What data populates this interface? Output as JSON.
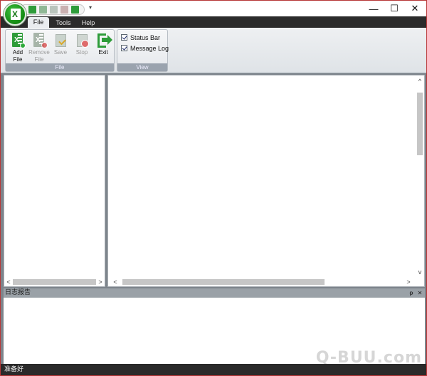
{
  "qat": {
    "icons": [
      "excel-add-icon",
      "excel-remove-icon",
      "save-icon",
      "stop-icon",
      "exit-icon"
    ],
    "dropdown_glyph": "▾"
  },
  "window_controls": {
    "minimize": "—",
    "maximize": "☐",
    "close": "✕"
  },
  "tabs": [
    {
      "label": "File",
      "active": true
    },
    {
      "label": "Tools",
      "active": false
    },
    {
      "label": "Help",
      "active": false
    }
  ],
  "ribbon": {
    "file_group": {
      "label": "File",
      "buttons": [
        {
          "line1": "Add",
          "line2": "File",
          "enabled": true
        },
        {
          "line1": "Remove",
          "line2": "File",
          "enabled": false
        },
        {
          "line1": "Save",
          "line2": "",
          "enabled": false
        },
        {
          "line1": "Stop",
          "line2": "",
          "enabled": false
        },
        {
          "line1": "Exit",
          "line2": "",
          "enabled": true
        }
      ]
    },
    "view_group": {
      "label": "View",
      "status_bar": {
        "label": "Status Bar",
        "checked": true
      },
      "message_log": {
        "label": "Message Log",
        "checked": true
      }
    }
  },
  "scroll": {
    "left": "<",
    "right": ">",
    "up": "^",
    "down": "v"
  },
  "log_panel": {
    "title": "日志报告",
    "pin": "ᵽ",
    "close": "✕"
  },
  "statusbar": {
    "text": "准备好"
  },
  "watermark": {
    "text": "Q-BUU.com"
  },
  "colors": {
    "accent_green": "#2e9c3a",
    "tab_bar": "#2b2b2b",
    "status_bar": "#2a2a2a",
    "window_border": "#b73737"
  }
}
